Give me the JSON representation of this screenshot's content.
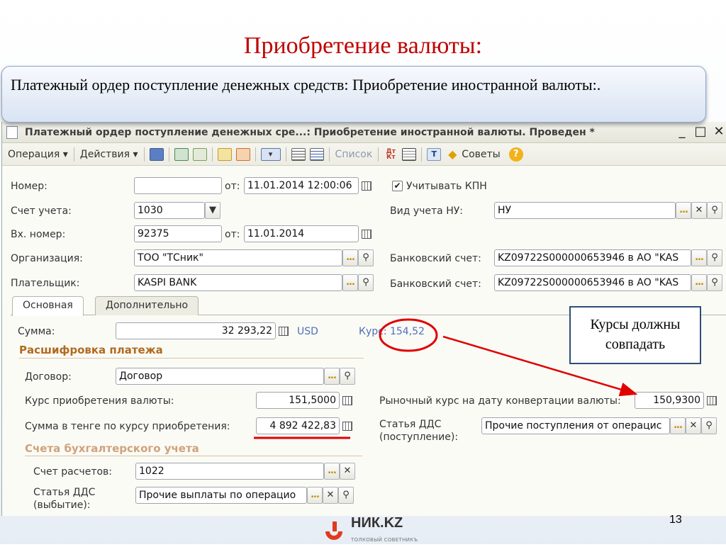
{
  "slide": {
    "title": "Приобретение валюты:",
    "callout_text": "Платежный ордер поступление денежных средств: Приобретение иностранной валюты:.",
    "annotation_line1": "Курсы должны",
    "annotation_line2": "совпадать",
    "page_number": "13",
    "logo_text": "НИК.KZ",
    "logo_subtitle": "ТОЛКОВЫЙ СОВЕТНИКЪ"
  },
  "window": {
    "title": "Платежный ордер поступление денежных сре...: Приобретение иностранной валюты. Проведен *",
    "minimize": "_",
    "maximize": "□",
    "close": "✕"
  },
  "toolbar": {
    "operation_label": "Операция ▾",
    "actions_label": "Действия ▾",
    "list_label": "Список",
    "dtkt_label": "Дт\nКт",
    "tips_label": "Советы",
    "help_label": "?"
  },
  "form": {
    "number_label": "Номер:",
    "number_value": "",
    "from_label_1": "от:",
    "date_value": "11.01.2014 12:00:06",
    "kpn_label": "Учитывать КПН",
    "kpn_checked": "✔",
    "account_label": "Счет учета:",
    "account_value": "1030",
    "nu_label": "Вид учета НУ:",
    "nu_value": "НУ",
    "incoming_label": "Вх. номер:",
    "incoming_value": "92375",
    "from_label_2": "от:",
    "incoming_date": "11.01.2014",
    "org_label": "Организация:",
    "org_value": "ТОО \"ТСник\"",
    "bank_account_label_1": "Банковский счет:",
    "bank_account_value_1": "KZ09722S000000653946 в АО \"KAS",
    "payer_label": "Плательщик:",
    "payer_value": "KASPI BANK",
    "bank_account_label_2": "Банковский счет:",
    "bank_account_value_2": "KZ09722S000000653946 в АО \"KAS"
  },
  "tabs": [
    {
      "label": "Основная"
    },
    {
      "label": "Дополнительно"
    }
  ],
  "main_tab": {
    "sum_label": "Сумма:",
    "sum_value": "32 293,22",
    "currency": "USD",
    "rate_label": "Курс: 154,52",
    "breakdown_title": "Расшифровка платежа",
    "contract_label": "Договор:",
    "contract_value": "Договор",
    "purchase_rate_label": "Курс приобретения валюты:",
    "purchase_rate_value": "151,5000",
    "market_rate_label": "Рыночный курс на дату конвертации валюты:",
    "market_rate_value": "150,9300",
    "tenge_sum_label": "Сумма в тенге по курсу приобретения:",
    "tenge_sum_value": "4 892 422,83",
    "dds_in_label_1": "Статья ДДС",
    "dds_in_label_2": "(поступление):",
    "dds_in_value": "Прочие поступления от операцис",
    "accounting_title": "Счета бухгалтерского учета",
    "settlement_label": "Счет расчетов:",
    "settlement_value": "1022",
    "dds_out_label_1": "Статья ДДС",
    "dds_out_label_2": "(выбытие):",
    "dds_out_value": "Прочие выплаты по операцио"
  },
  "colors": {
    "title_red": "#c00000",
    "highlight_red": "#e00000",
    "section_orange": "#b06a1f",
    "link_blue": "#4f6fb8",
    "annotation_border": "#2f4d78"
  }
}
